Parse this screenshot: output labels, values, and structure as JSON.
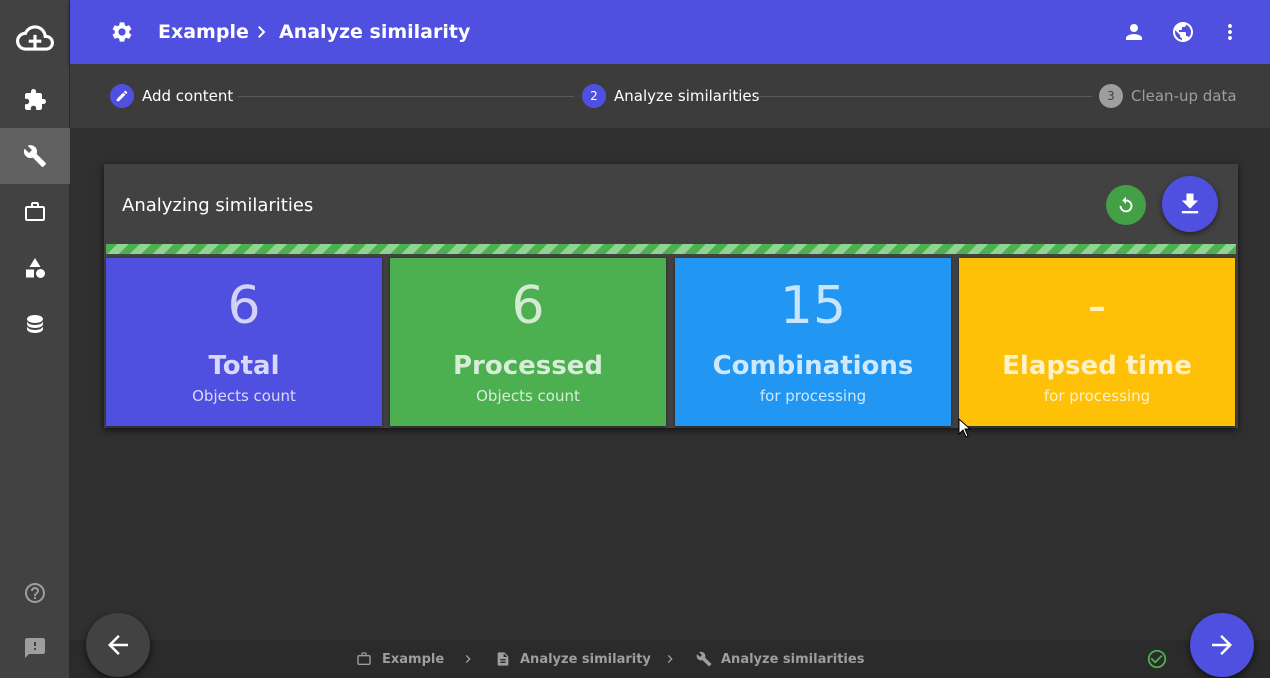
{
  "header": {
    "crumb_project": "Example",
    "crumb_page": "Analyze similarity"
  },
  "stepper": {
    "steps": [
      {
        "label": "Add content",
        "number": ""
      },
      {
        "label": "Analyze similarities",
        "number": "2"
      },
      {
        "label": "Clean-up data",
        "number": "3"
      }
    ]
  },
  "card": {
    "title": "Analyzing similarities",
    "progress": 1.0,
    "tiles": [
      {
        "value": "6",
        "label": "Total",
        "sub": "Objects count",
        "color": "#5050e0"
      },
      {
        "value": "6",
        "label": "Processed",
        "sub": "Objects count",
        "color": "#4caf50"
      },
      {
        "value": "15",
        "label": "Combinations",
        "sub": "for processing",
        "color": "#2196f3"
      },
      {
        "value": "-",
        "label": "Elapsed time",
        "sub": "for processing",
        "color": "#ffc107"
      }
    ]
  },
  "footer": {
    "crumbs": [
      "Example",
      "Analyze similarity",
      "Analyze similarities"
    ]
  },
  "colors": {
    "accent": "#5050e0",
    "success": "#4caf50"
  },
  "icons": {
    "sidebar": [
      "cloud-upload-icon",
      "puzzle-icon",
      "wrench-icon",
      "briefcase-icon",
      "shapes-icon",
      "database-icon",
      "help-icon",
      "feedback-icon"
    ]
  }
}
